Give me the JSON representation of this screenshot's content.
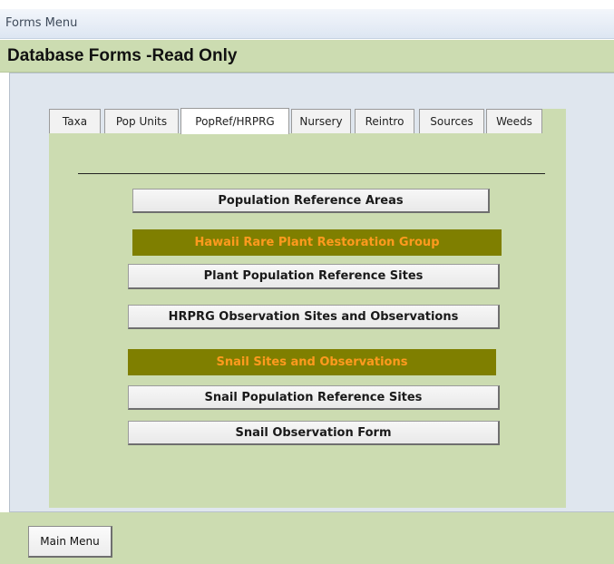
{
  "window": {
    "title": "Forms Menu"
  },
  "header": {
    "title": "Database Forms -Read Only"
  },
  "tabs": [
    {
      "label": "Taxa"
    },
    {
      "label": "Pop Units"
    },
    {
      "label": "PopRef/HRPRG",
      "active": true
    },
    {
      "label": "Nursery"
    },
    {
      "label": "Reintro"
    },
    {
      "label": "Sources"
    },
    {
      "label": "Weeds"
    }
  ],
  "content": {
    "population_reference_areas": "Population Reference Areas",
    "hrprg_banner": "Hawaii Rare Plant Restoration Group",
    "plant_population_reference_sites": "Plant Population Reference Sites",
    "hrprg_observation_sites": "HRPRG Observation Sites and Observations",
    "snail_banner": "Snail Sites and Observations",
    "snail_population_reference_sites": "Snail Population Reference Sites",
    "snail_observation_form": "Snail Observation Form"
  },
  "footer": {
    "main_menu": "Main Menu"
  },
  "colors": {
    "form_green": "#ccdcb1",
    "detail_gray_blue": "#dfe6ee",
    "banner_olive": "#7f7f00",
    "banner_text_orange": "#ff9a1e"
  }
}
